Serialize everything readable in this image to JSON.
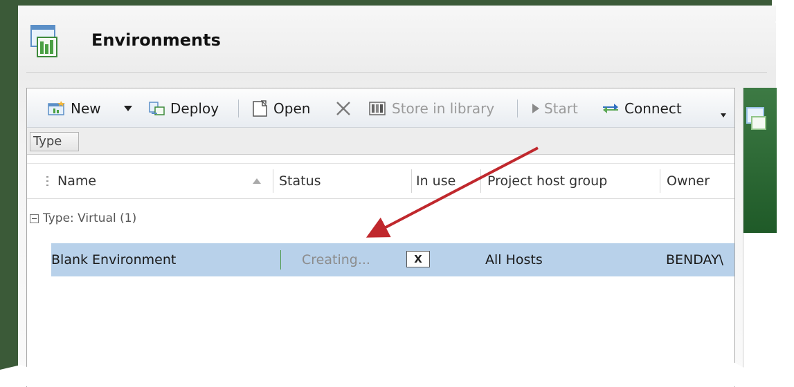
{
  "window": {
    "title": "Environments"
  },
  "toolbar": {
    "new_label": "New",
    "deploy_label": "Deploy",
    "open_label": "Open",
    "store_label": "Store in library",
    "start_label": "Start",
    "connect_label": "Connect"
  },
  "groupby": {
    "chip_label": "Type"
  },
  "columns": {
    "name": "Name",
    "status": "Status",
    "in_use": "In use",
    "project_host_group": "Project host group",
    "owner": "Owner"
  },
  "groups": [
    {
      "label": "Type: Virtual (1)"
    }
  ],
  "rows": [
    {
      "name": "Blank Environment",
      "status": "Creating...",
      "cancel": "X",
      "project_host_group": "All Hosts",
      "owner": "BENDAY\\"
    }
  ],
  "colors": {
    "selection": "#b8d1ea",
    "arrow": "#c0282d",
    "frame_green": "#3b5a38"
  },
  "icons": [
    "environments-icon",
    "new-icon",
    "deploy-icon",
    "open-icon",
    "delete-icon",
    "store-library-icon",
    "start-icon",
    "connect-icon"
  ]
}
